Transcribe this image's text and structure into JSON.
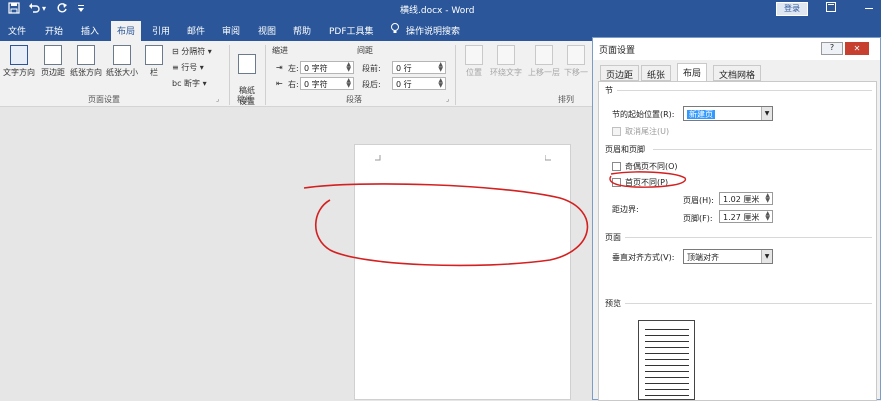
{
  "window": {
    "title": "横线.docx - Word",
    "login": "登录",
    "ribbon_display_icon": "ribbon-display-icon",
    "minimize_icon": "minimize-icon"
  },
  "quick_access": {
    "save_icon": "save-icon",
    "undo_icon": "undo-icon",
    "undo_dropdown": "▾",
    "redo_icon": "redo-icon",
    "customize_icon": "customize-icon"
  },
  "tabs": [
    "文件",
    "开始",
    "插入",
    "布局",
    "引用",
    "邮件",
    "审阅",
    "视图",
    "帮助",
    "PDF工具集"
  ],
  "active_tab": "布局",
  "tell_me": {
    "icon": "lightbulb-icon",
    "label": "操作说明搜索"
  },
  "ribbon": {
    "page_setup": {
      "buttons": [
        {
          "label": "文字方向",
          "icon": "text-direction-icon"
        },
        {
          "label": "页边距",
          "icon": "margins-icon"
        },
        {
          "label": "纸张方向",
          "icon": "orientation-icon"
        },
        {
          "label": "纸张大小",
          "icon": "paper-size-icon"
        },
        {
          "label": "栏",
          "icon": "columns-icon"
        }
      ],
      "small": [
        "分隔符",
        "行号",
        "断字"
      ],
      "group_label": "页面设置"
    },
    "draft": {
      "label": "稿纸\n设置",
      "group_label": "稿纸"
    },
    "paragraph": {
      "indent_header": "缩进",
      "spacing_header": "间距",
      "left_label": "左:",
      "left_value": "0 字符",
      "right_label": "右:",
      "right_value": "0 字符",
      "before_label": "段前:",
      "before_value": "0 行",
      "after_label": "段后:",
      "after_value": "0 行",
      "group_label": "段落"
    },
    "arrange": {
      "buttons": [
        "位置",
        "环绕文字",
        "上移一层",
        "下移一"
      ],
      "group_label": "排列"
    }
  },
  "dialog": {
    "title": "页面设置",
    "help": "?",
    "close": "✕",
    "tabs": [
      "页边距",
      "纸张",
      "布局",
      "文档网格"
    ],
    "active_tab": "布局",
    "section": {
      "header": "节",
      "start_label": "节的起始位置(R):",
      "start_value": "新建页",
      "suppress_endnotes": "取消尾注(U)"
    },
    "headers_footers": {
      "header": "页眉和页脚",
      "odd_even": "奇偶页不同(O)",
      "first_page": "首页不同(P)",
      "from_edge": "距边界:",
      "header_label": "页眉(H):",
      "header_value": "1.02 厘米",
      "footer_label": "页脚(F):",
      "footer_value": "1.27 厘米"
    },
    "page": {
      "header": "页面",
      "valign_label": "垂直对齐方式(V):",
      "valign_value": "顶端对齐"
    },
    "preview": {
      "header": "预览"
    }
  },
  "annotation_color": "#d42020"
}
